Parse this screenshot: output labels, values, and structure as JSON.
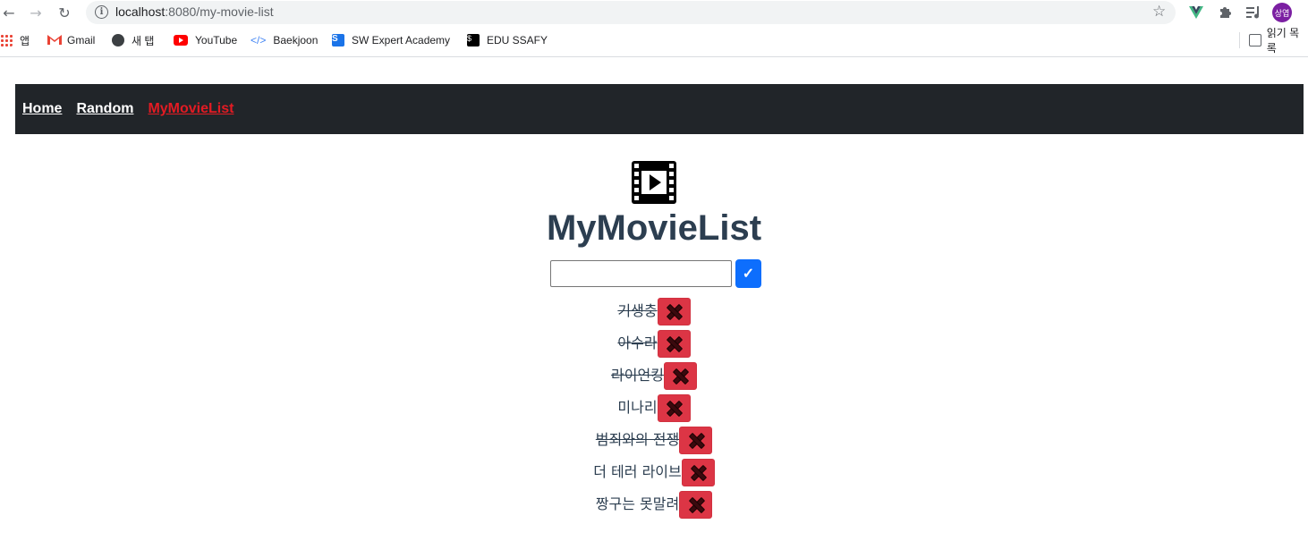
{
  "browser": {
    "url_host": "localhost",
    "url_rest": ":8080/my-movie-list",
    "avatar_text": "상엽",
    "reading_list_label": "읽기 목록"
  },
  "bookmarks": [
    {
      "label": "앱",
      "icon": "apps-icon"
    },
    {
      "label": "Gmail",
      "icon": "gmail-icon"
    },
    {
      "label": "새 탭",
      "icon": "globe-icon"
    },
    {
      "label": "YouTube",
      "icon": "youtube-icon"
    },
    {
      "label": "Baekjoon",
      "icon": "code-icon"
    },
    {
      "label": "SW Expert Academy",
      "icon": "swea-icon"
    },
    {
      "label": "EDU SSAFY",
      "icon": "edu-ssafy-icon"
    }
  ],
  "nav": {
    "home": "Home",
    "random": "Random",
    "my_movie_list": "MyMovieList",
    "active_color": "#e31b23"
  },
  "page": {
    "title": "MyMovieList",
    "input_value": "",
    "add_button_label": "✓",
    "header_icon": "film-icon"
  },
  "movies": [
    {
      "title": "기생충",
      "completed": true
    },
    {
      "title": "아수라",
      "completed": true
    },
    {
      "title": "라이언킹",
      "completed": true
    },
    {
      "title": "미나리",
      "completed": false
    },
    {
      "title": "범죄와의 전쟁",
      "completed": true
    },
    {
      "title": "더 테러 라이브",
      "completed": false
    },
    {
      "title": "짱구는 못말려",
      "completed": false
    }
  ],
  "colors": {
    "navbar_bg": "#212529",
    "add_button": "#0d6efd",
    "delete_button": "#dc3545",
    "text": "#2c3e50"
  }
}
